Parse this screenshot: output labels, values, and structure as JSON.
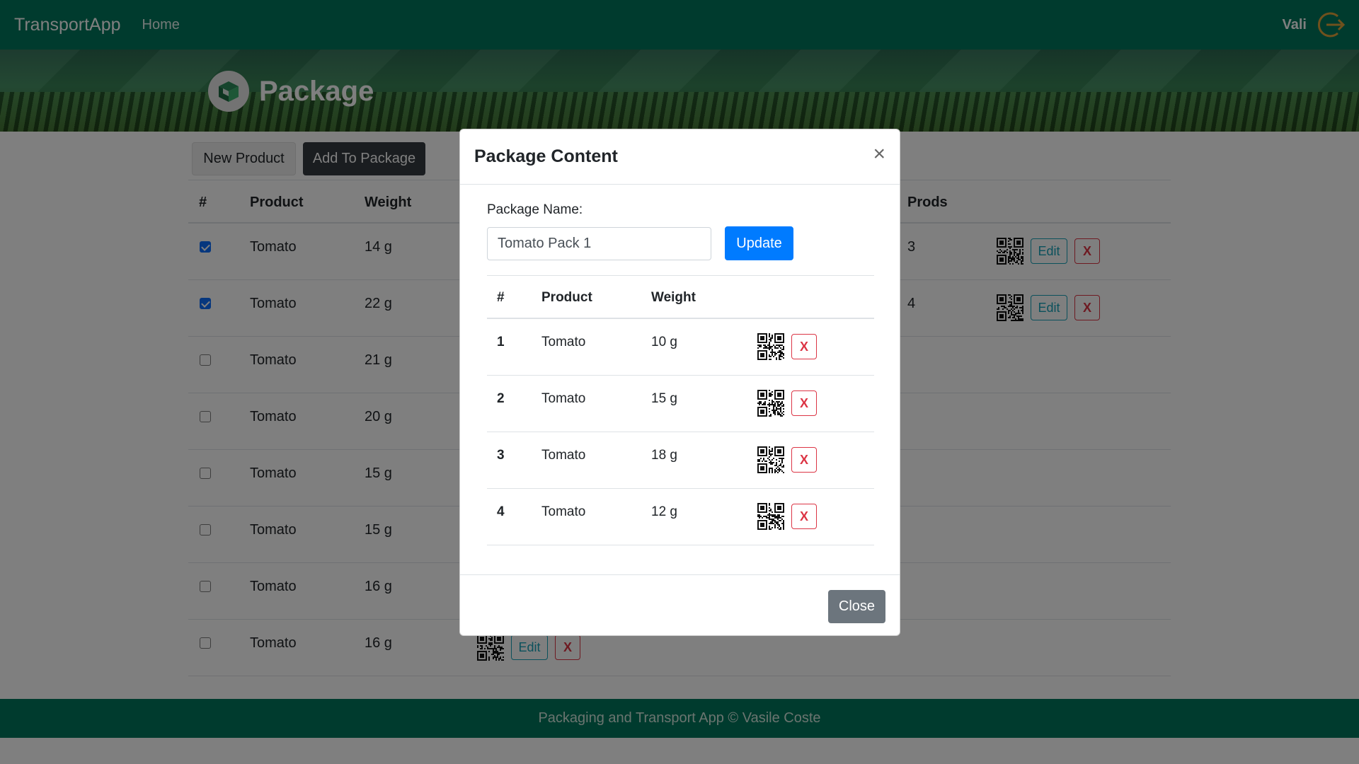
{
  "navbar": {
    "brand": "TransportApp",
    "home": "Home",
    "user": "Vali",
    "logout_icon": "logout-icon"
  },
  "hero": {
    "title": "Package",
    "icon": "package-box-icon"
  },
  "toolbar": {
    "new_product": "New Product",
    "add_to_package": "Add To Package"
  },
  "product_table": {
    "headers": [
      "#",
      "Product",
      "Weight",
      "Prods"
    ],
    "rows": [
      {
        "checked": true,
        "product": "Tomato",
        "weight": "14 g"
      },
      {
        "checked": true,
        "product": "Tomato",
        "weight": "22 g"
      },
      {
        "checked": false,
        "product": "Tomato",
        "weight": "21 g"
      },
      {
        "checked": false,
        "product": "Tomato",
        "weight": "20 g"
      },
      {
        "checked": false,
        "product": "Tomato",
        "weight": "15 g"
      },
      {
        "checked": false,
        "product": "Tomato",
        "weight": "15 g"
      },
      {
        "checked": false,
        "product": "Tomato",
        "weight": "16 g"
      },
      {
        "checked": false,
        "product": "Tomato",
        "weight": "16 g"
      }
    ],
    "packages": [
      {
        "prods": "3",
        "edit": "Edit",
        "delete": "X"
      },
      {
        "prods": "4",
        "edit": "Edit",
        "delete": "X"
      }
    ],
    "last_row_actions": {
      "edit": "Edit",
      "delete": "X"
    }
  },
  "modal": {
    "title": "Package Content",
    "close_symbol": "×",
    "package_name_label": "Package Name:",
    "package_name_value": "Tomato Pack 1",
    "update": "Update",
    "headers": [
      "#",
      "Product",
      "Weight"
    ],
    "rows": [
      {
        "index": "1",
        "product": "Tomato",
        "weight": "10 g",
        "delete": "X"
      },
      {
        "index": "2",
        "product": "Tomato",
        "weight": "15 g",
        "delete": "X"
      },
      {
        "index": "3",
        "product": "Tomato",
        "weight": "18 g",
        "delete": "X"
      },
      {
        "index": "4",
        "product": "Tomato",
        "weight": "12 g",
        "delete": "X"
      }
    ],
    "close": "Close"
  },
  "footer": {
    "text": "Packaging and Transport App © Vasile Coste"
  },
  "colors": {
    "navbar": "#00765d",
    "primary": "#007bff",
    "danger": "#dc3545",
    "info": "#17a2b8",
    "dark": "#343a40",
    "secondary": "#6c757d"
  }
}
